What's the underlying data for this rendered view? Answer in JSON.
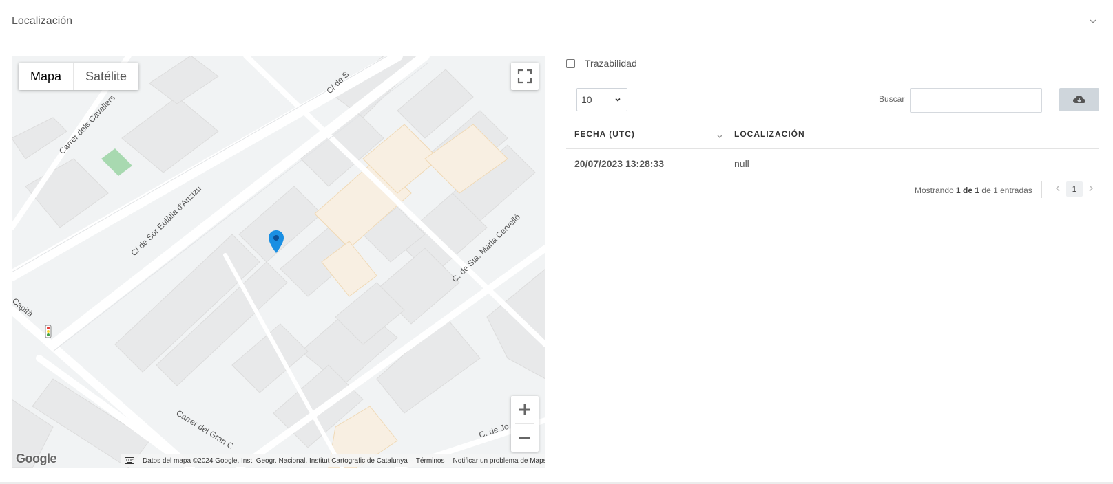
{
  "panel": {
    "title": "Localización",
    "collapse_icon": "chevron-down-icon"
  },
  "map": {
    "map_type": {
      "map": "Mapa",
      "satellite": "Satélite"
    },
    "street_labels": [
      "Carrer dels Cavallers",
      "C/ de Sor Eulàlia d'Anzizu",
      "C. de Sta. Maria Cervelló",
      "Carrer del Gran C",
      "C. de Jo",
      "Capità",
      "C/ de S"
    ],
    "logo": "Google",
    "attribution": {
      "data": "Datos del mapa ©2024 Google, Inst. Geogr. Nacional, Institut Cartografic de Catalunya",
      "terms": "Términos",
      "report": "Notificar un problema de Maps"
    },
    "icons": {
      "fullscreen": "fullscreen-icon",
      "zoom_in": "plus-icon",
      "zoom_out": "minus-icon",
      "marker": "map-pin-icon",
      "keyboard": "keyboard-icon"
    }
  },
  "trace": {
    "label": "Trazabilidad",
    "checked": false
  },
  "table": {
    "length": "10",
    "search_label": "Buscar",
    "search_value": "",
    "download_icon": "cloud-download-icon",
    "columns": [
      "FECHA (UTC)",
      "LOCALIZACIÓN"
    ],
    "rows": [
      {
        "date": "20/07/2023 13:28:33",
        "location": "null"
      }
    ],
    "info": {
      "prefix": "Mostrando ",
      "from": "1",
      "de": " de ",
      "to": "1",
      "suffix": " de 1 entradas"
    },
    "pagination": {
      "current": "1"
    }
  }
}
